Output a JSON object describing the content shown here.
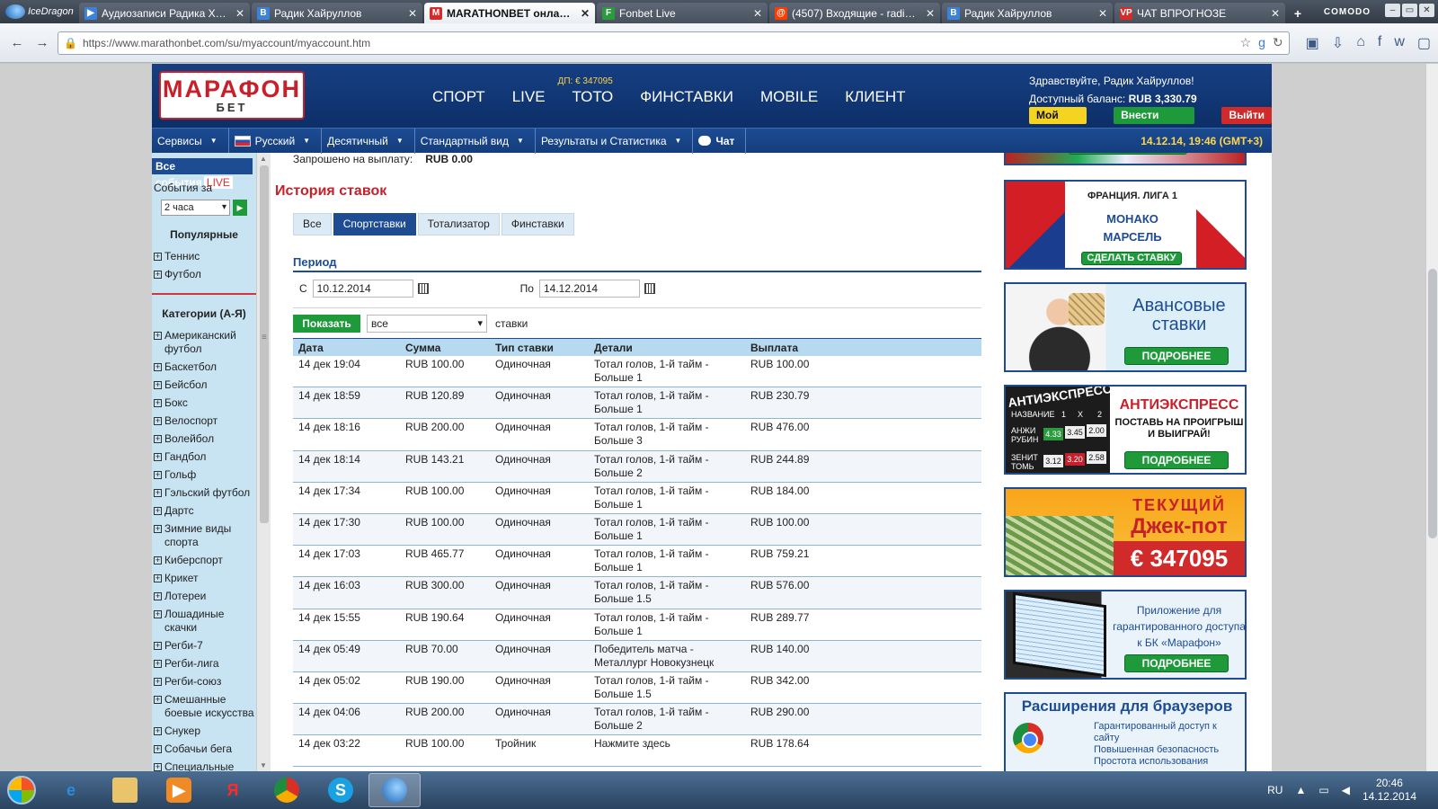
{
  "browser": {
    "brand": "IceDragon",
    "tabs": [
      {
        "label": "Аудиозаписи Радика Хайр...",
        "icon": "play-icon",
        "active": false
      },
      {
        "label": "Радик Хайруллов",
        "icon": "vk-icon",
        "active": false
      },
      {
        "label": "MARATHONBET онлайн ...",
        "icon": "marathon-icon",
        "active": true
      },
      {
        "label": "Fonbet Live",
        "icon": "fonbet-icon",
        "active": false
      },
      {
        "label": "(4507) Входящие - radique...",
        "icon": "mail-icon",
        "active": false
      },
      {
        "label": "Радик Хайруллов",
        "icon": "vk-icon",
        "active": false
      },
      {
        "label": "ЧАТ ВПРОГНОЗЕ",
        "icon": "vp-icon",
        "active": false
      }
    ],
    "window_brand": "COMODO",
    "url": "https://www.marathonbet.com/su/myaccount/myaccount.htm"
  },
  "site": {
    "logo_line1": "МАРАФОН",
    "logo_line2": "БЕТ",
    "nav": [
      "СПОРТ",
      "LIVE",
      "ТОТО",
      "ФИНСТАВКИ",
      "MOBILE",
      "КЛИЕНТ"
    ],
    "toto_badge": "ДП: € 347095",
    "greeting": "Здравствуйте, Радик Хайруллов!",
    "balance_label": "Доступный баланс:",
    "balance_value": "RUB 3,330.79",
    "btn_account": "Мой счет",
    "btn_deposit": "Внести сумму",
    "btn_logout": "Выйти",
    "subnav": {
      "services": "Сервисы",
      "language": "Русский",
      "odds": "Десятичный",
      "view": "Стандартный вид",
      "results": "Результаты и Статистика",
      "chat": "Чат",
      "datetime": "14.12.14, 19:46 (GMT+3)"
    }
  },
  "sidebar": {
    "all_events": "Все события",
    "live": "LIVE",
    "events_for": "События за",
    "period_value": "2 часа",
    "popular": "Популярные",
    "popular_items": [
      "Теннис",
      "Футбол"
    ],
    "categories": "Категории (А-Я)",
    "category_items": [
      "Американский футбол",
      "Баскетбол",
      "Бейсбол",
      "Бокс",
      "Велоспорт",
      "Волейбол",
      "Гандбол",
      "Гольф",
      "Гэльский футбол",
      "Дартс",
      "Зимние виды спорта",
      "Киберспорт",
      "Крикет",
      "Лотереи",
      "Лошадиные скачки",
      "Регби-7",
      "Регби-лига",
      "Регби-союз",
      "Смешанные боевые искусства",
      "Снукер",
      "Собачьи бега",
      "Специальные"
    ]
  },
  "content": {
    "requested_label": "Запрошено на выплату:",
    "requested_value": "RUB 0.00",
    "title": "История ставок",
    "tabs": [
      "Все",
      "Спортставки",
      "Тотализатор",
      "Финставки"
    ],
    "active_tab": 1,
    "period": "Период",
    "from_label": "С",
    "from_value": "10.12.2014",
    "to_label": "По",
    "to_value": "14.12.2014",
    "show_button": "Показать",
    "filter_value": "все",
    "filter_suffix": "ставки",
    "columns": [
      "Дата",
      "Сумма",
      "Тип ставки",
      "Детали",
      "Выплата"
    ],
    "rows": [
      {
        "date": "14 дек 19:04",
        "sum": "RUB 100.00",
        "type": "Одиночная",
        "d1": "Тотал голов, 1-й тайм -",
        "d2": "Больше 1",
        "payout": "RUB 100.00"
      },
      {
        "date": "14 дек 18:59",
        "sum": "RUB 120.89",
        "type": "Одиночная",
        "d1": "Тотал голов, 1-й тайм -",
        "d2": "Больше 1",
        "payout": "RUB 230.79"
      },
      {
        "date": "14 дек 18:16",
        "sum": "RUB 200.00",
        "type": "Одиночная",
        "d1": "Тотал голов, 1-й тайм -",
        "d2": "Больше 3",
        "payout": "RUB 476.00"
      },
      {
        "date": "14 дек 18:14",
        "sum": "RUB 143.21",
        "type": "Одиночная",
        "d1": "Тотал голов, 1-й тайм -",
        "d2": "Больше 2",
        "payout": "RUB 244.89"
      },
      {
        "date": "14 дек 17:34",
        "sum": "RUB 100.00",
        "type": "Одиночная",
        "d1": "Тотал голов, 1-й тайм -",
        "d2": "Больше 1",
        "payout": "RUB 184.00"
      },
      {
        "date": "14 дек 17:30",
        "sum": "RUB 100.00",
        "type": "Одиночная",
        "d1": "Тотал голов, 1-й тайм -",
        "d2": "Больше 1",
        "payout": "RUB 100.00"
      },
      {
        "date": "14 дек 17:03",
        "sum": "RUB 465.77",
        "type": "Одиночная",
        "d1": "Тотал голов, 1-й тайм -",
        "d2": "Больше 1",
        "payout": "RUB 759.21"
      },
      {
        "date": "14 дек 16:03",
        "sum": "RUB 300.00",
        "type": "Одиночная",
        "d1": "Тотал голов, 1-й тайм -",
        "d2": "Больше 1.5",
        "payout": "RUB 576.00"
      },
      {
        "date": "14 дек 15:55",
        "sum": "RUB 190.64",
        "type": "Одиночная",
        "d1": "Тотал голов, 1-й тайм -",
        "d2": "Больше 1",
        "payout": "RUB 289.77"
      },
      {
        "date": "14 дек 05:49",
        "sum": "RUB 70.00",
        "type": "Одиночная",
        "d1": "Победитель матча -",
        "d2": "Металлург Новокузнецк",
        "payout": "RUB 140.00"
      },
      {
        "date": "14 дек 05:02",
        "sum": "RUB 190.00",
        "type": "Одиночная",
        "d1": "Тотал голов, 1-й тайм -",
        "d2": "Больше 1.5",
        "payout": "RUB 342.00"
      },
      {
        "date": "14 дек 04:06",
        "sum": "RUB 200.00",
        "type": "Одиночная",
        "d1": "Тотал голов, 1-й тайм -",
        "d2": "Больше 2",
        "payout": "RUB 290.00"
      },
      {
        "date": "14 дек 03:22",
        "sum": "RUB 100.00",
        "type": "Тройник",
        "d1": "Нажмите здесь",
        "d2": "",
        "payout": "RUB 178.64"
      }
    ]
  },
  "banners": {
    "make_bet": "СДЕЛАТЬ СТАВКУ",
    "league": "ФРАНЦИЯ. ЛИГА 1",
    "team1": "МОНАКО",
    "team2": "МАРСЕЛЬ",
    "advance_title": "Авансовые ставки",
    "more": "ПОДРОБНЕЕ",
    "antiexpress_board": "АНТИЭКСПРЕСС",
    "antiexpress_board_header": "НАЗВАНИЕ",
    "antiexpress_cols": [
      "1",
      "X",
      "2"
    ],
    "antiexpress_team1": "АНЖИ РУБИН",
    "antiexpress_team2": "ЗЕНИТ ТОМЬ",
    "antiexpress_odds1": [
      "4.33",
      "3.45",
      "2.00"
    ],
    "antiexpress_odds2": [
      "3.12",
      "3.20",
      "2.58"
    ],
    "antiexpress_title": "АНТИЭКСПРЕСС",
    "antiexpress_sub": "ПОСТАВЬ НА ПРОИГРЫШ И ВЫИГРАЙ!",
    "jackpot_line1": "ТЕКУЩИЙ",
    "jackpot_line2": "Джек-пот",
    "jackpot_amount": "€ 347095",
    "app_text": "Приложение для гарантированного доступа к БК «Марафон»",
    "ext_title": "Расширения для браузеров",
    "ext_items": [
      "Гарантированный доступ к сайту",
      "Повышенная безопасность",
      "Простота использования"
    ]
  },
  "taskbar": {
    "lang": "RU",
    "time": "20:46",
    "date": "14.12.2014"
  }
}
